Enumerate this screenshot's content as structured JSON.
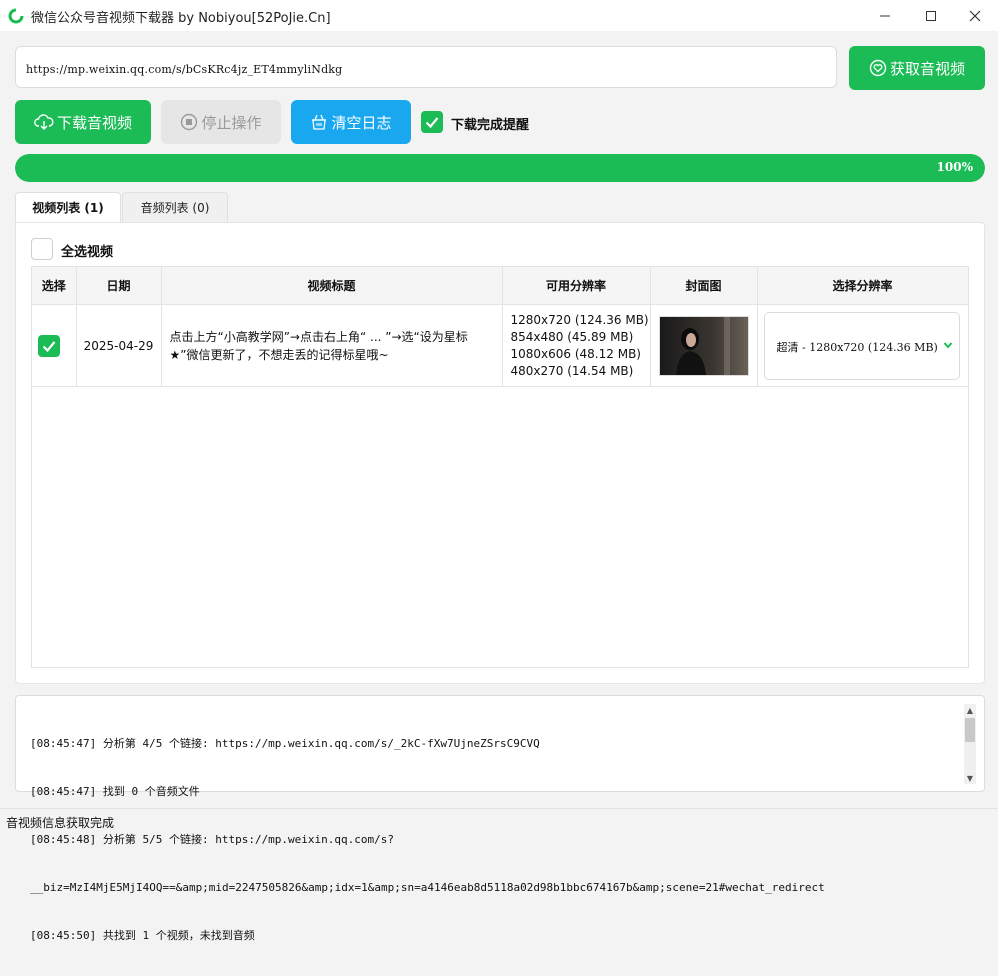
{
  "window": {
    "title": "微信公众号音视频下载器 by Nobiyou[52PoJie.Cn]",
    "icon": "app-logo-icon"
  },
  "url_input": {
    "value": "https://mp.weixin.qq.com/s/bCsKRc4jz_ET4mmyliNdkg"
  },
  "buttons": {
    "fetch_label": "获取音视频",
    "download_label": "下载音视频",
    "stop_label": "停止操作",
    "clear_label": "清空日志"
  },
  "notify": {
    "label": "下载完成提醒",
    "checked": true
  },
  "progress": {
    "value": 1.0,
    "text": "100%"
  },
  "tabs": [
    {
      "label": "视频列表 (1)",
      "active": true
    },
    {
      "label": "音频列表 (0)",
      "active": false
    }
  ],
  "select_all": {
    "label": "全选视频",
    "checked": false
  },
  "table": {
    "headers": [
      "选择",
      "日期",
      "视频标题",
      "可用分辨率",
      "封面图",
      "选择分辨率"
    ],
    "rows": [
      {
        "checked": true,
        "date": "2025-04-29",
        "title": "点击上方“小高教学网”→点击右上角“ ... ”→选“设为星标★”微信更新了，不想走丢的记得标星哦~",
        "resolutions": [
          "1280x720 (124.36 MB)",
          "854x480 (45.89 MB)",
          "1080x606 (48.12 MB)",
          "480x270 (14.54 MB)"
        ],
        "selected_resolution": "超清 - 1280x720 (124.36 MB)"
      }
    ]
  },
  "log": {
    "lines": [
      "[08:45:47] 分析第 4/5 个链接: https://mp.weixin.qq.com/s/_2kC-fXw7UjneZSrsC9CVQ",
      "[08:45:47] 找到 0 个音频文件",
      "[08:45:48] 分析第 5/5 个链接: https://mp.weixin.qq.com/s?",
      "__biz=MzI4MjE5MjI4OQ==&amp;mid=2247505826&amp;idx=1&amp;sn=a4146eab8d5118a02d98b1bbc674167b&amp;scene=21#wechat_redirect",
      "[08:45:50] 共找到 1 个视频，未找到音频"
    ]
  },
  "status": {
    "text": "音视频信息获取完成"
  },
  "colors": {
    "green": "#1bbb56",
    "blue": "#19a8f0",
    "disabled": "#e6e6e6"
  }
}
